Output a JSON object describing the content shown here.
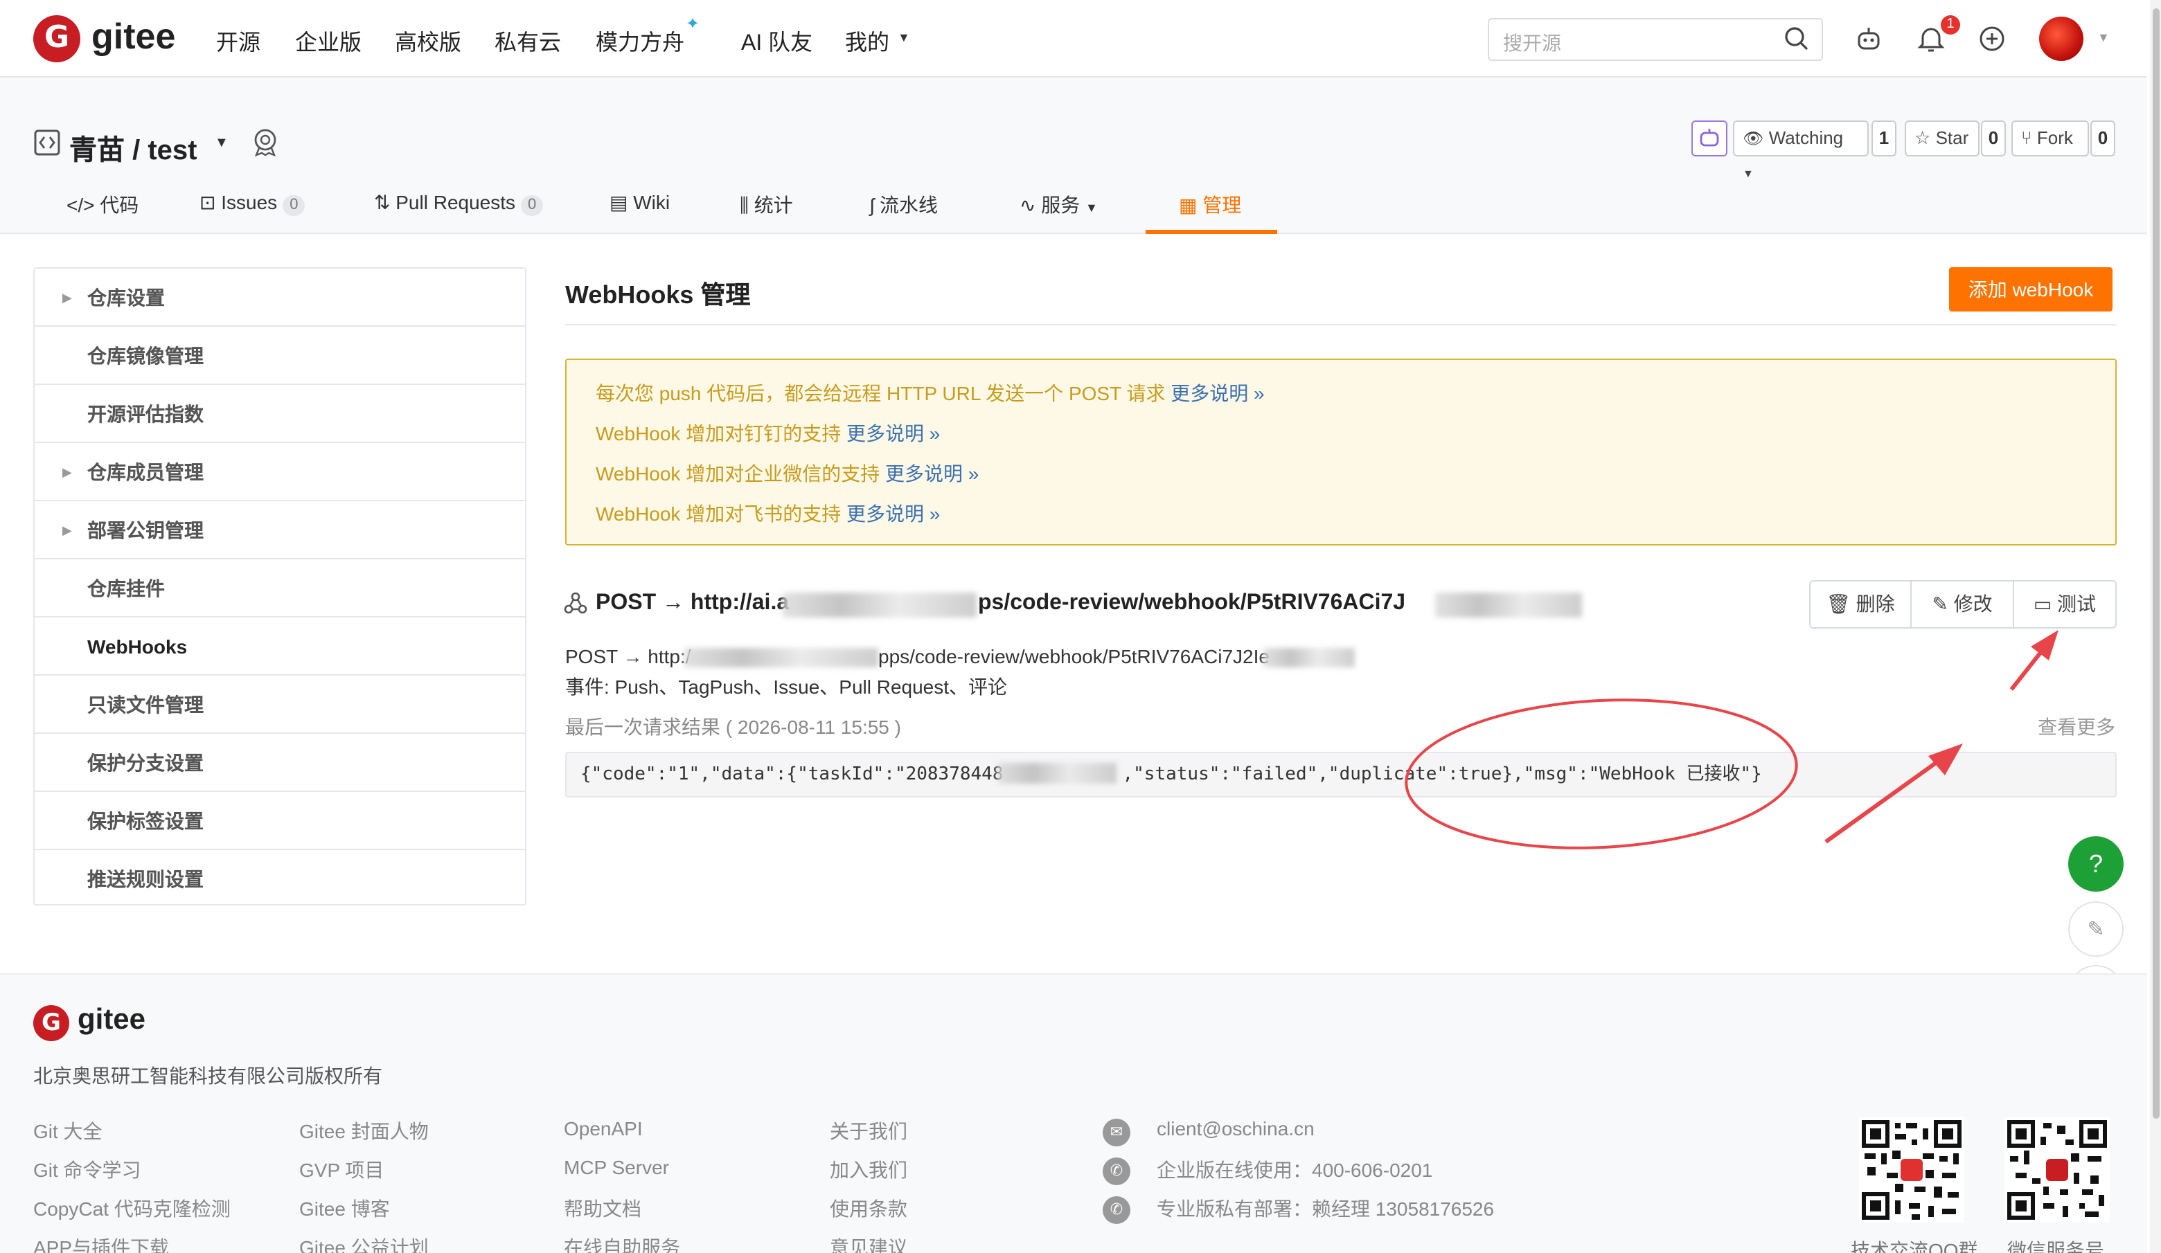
{
  "nav": {
    "logo_letter": "G",
    "logo_text": "gitee",
    "links": [
      "开源",
      "企业版",
      "高校版",
      "私有云",
      "模力方舟",
      "AI 队友",
      "我的"
    ],
    "search_placeholder": "搜开源",
    "notification_count": "1"
  },
  "repo": {
    "title": "青苗 / test",
    "watching_label": "Watching",
    "watching_count": "1",
    "star_label": "Star",
    "star_count": "0",
    "fork_label": "Fork",
    "fork_count": "0",
    "tabs": [
      {
        "label": "代码",
        "badge": ""
      },
      {
        "label": "Issues",
        "badge": "0"
      },
      {
        "label": "Pull Requests",
        "badge": "0"
      },
      {
        "label": "Wiki",
        "badge": ""
      },
      {
        "label": "统计",
        "badge": ""
      },
      {
        "label": "流水线",
        "badge": ""
      },
      {
        "label": "服务",
        "badge": ""
      },
      {
        "label": "管理",
        "badge": ""
      }
    ]
  },
  "sidebar": {
    "items": [
      "仓库设置",
      "仓库镜像管理",
      "开源评估指数",
      "仓库成员管理",
      "部署公钥管理",
      "仓库挂件",
      "WebHooks",
      "只读文件管理",
      "保护分支设置",
      "保护标签设置",
      "推送规则设置"
    ]
  },
  "main": {
    "title": "WebHooks 管理",
    "add_button": "添加 webHook",
    "notices": [
      {
        "text": "每次您 push 代码后，都会给远程 HTTP URL 发送一个 POST 请求",
        "more": "更多说明 »"
      },
      {
        "text": "WebHook 增加对钉钉的支持",
        "more": "更多说明 »"
      },
      {
        "text": "WebHook 增加对企业微信的支持",
        "more": "更多说明 »"
      },
      {
        "text": "WebHook 增加对飞书的支持",
        "more": "更多说明 »"
      }
    ],
    "hook": {
      "heading_prefix": "POST → http://ai.a",
      "heading_suffix": "ps/code-review/webhook/P5tRIV76ACi7J",
      "detail_prefix": "POST → http:/",
      "detail_suffix": "pps/code-review/webhook/P5tRIV76ACi7J2Ie",
      "events": "事件:   Push、TagPush、Issue、Pull Request、评论",
      "delete_label": "删除",
      "edit_label": "修改",
      "test_label": "测试",
      "last_result": "最后一次请求结果 ( 2026-08-11 15:55 )",
      "see_more": "查看更多",
      "response_prefix": "{\"code\":\"1\",\"data\":{\"taskId\":\"208378448",
      "response_suffix": ",\"status\":\"failed\",\"duplicate\":true},\"msg\":\"WebHook 已接收\"}"
    }
  },
  "footer": {
    "logo_text": "gitee",
    "copyright": "北京奥思研工智能科技有限公司版权所有",
    "col1": [
      "Git 大全",
      "Git 命令学习",
      "CopyCat 代码克隆检测",
      "APP与插件下载"
    ],
    "col2": [
      "Gitee 封面人物",
      "GVP 项目",
      "Gitee 博客",
      "Gitee 公益计划"
    ],
    "col3": [
      "OpenAPI",
      "MCP Server",
      "帮助文档",
      "在线自助服务"
    ],
    "col4": [
      "关于我们",
      "加入我们",
      "使用条款",
      "意见建议"
    ],
    "contacts": [
      "client@oschina.cn",
      "企业版在线使用：400-606-0201",
      "专业版私有部署：赖经理 13058176526"
    ],
    "qr1_label": "技术交流QQ群",
    "qr2_label": "微信服务号"
  },
  "colors": {
    "accent": "#fe7300",
    "brand": "#c71d23",
    "annotation": "#e8454a"
  }
}
